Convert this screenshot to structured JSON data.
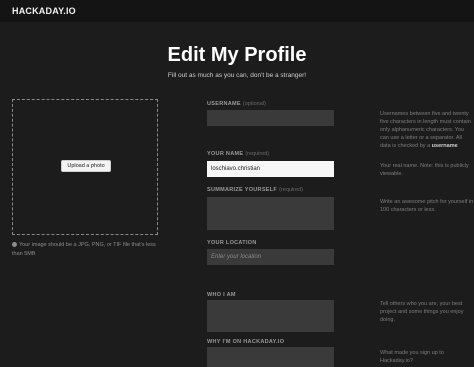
{
  "header": {
    "logo": "HACKADAY.IO"
  },
  "page": {
    "title": "Edit My Profile",
    "subtitle": "Fill out as much as you can, don't be a stranger!"
  },
  "avatar": {
    "upload_label": "Upload a photo",
    "note": "Your image should be a JPG, PNG, or TIF file that's less than 5MB"
  },
  "form": {
    "username": {
      "label": "USERNAME",
      "optional": "(optional)",
      "value": "",
      "hint_pre": "Usernames between five and twenty five characters in length must contain only alphanumeric characters. You can use a letter or a separator. All data is checked by a ",
      "hint_strong": "username"
    },
    "your_name": {
      "label": "YOUR NAME",
      "optional": "(required)",
      "value": "loschiavo.christian",
      "hint": "Your real name. Note: this is publicly viewable."
    },
    "summarize": {
      "label": "SUMMARIZE YOURSELF",
      "optional": "(required)",
      "value": "",
      "hint": "Write an awesome pitch for yourself in 100 characters or less."
    },
    "location": {
      "label": "YOUR LOCATION",
      "placeholder": "Enter your location"
    },
    "who_i_am": {
      "label": "WHO I AM",
      "value": "",
      "hint": "Tell others who you are, your best project and some things you enjoy doing."
    },
    "why_here": {
      "label": "WHY I'M ON HACKADAY.IO",
      "value": "",
      "hint": "What made you sign up to Hackaday.io?"
    }
  }
}
